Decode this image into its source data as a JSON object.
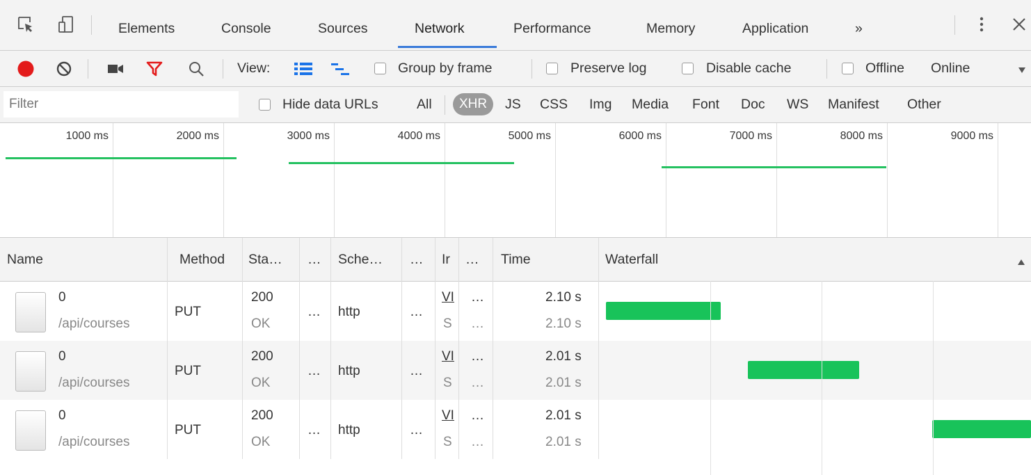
{
  "tabs": {
    "elements": "Elements",
    "console": "Console",
    "sources": "Sources",
    "network": "Network",
    "performance": "Performance",
    "memory": "Memory",
    "application": "Application",
    "more": "»"
  },
  "toolbar": {
    "view_label": "View:",
    "group_by_frame": "Group by frame",
    "preserve_log": "Preserve log",
    "disable_cache": "Disable cache",
    "offline": "Offline",
    "throttle": "Online"
  },
  "filter": {
    "placeholder": "Filter",
    "hide_data_urls": "Hide data URLs",
    "types": [
      "All",
      "XHR",
      "JS",
      "CSS",
      "Img",
      "Media",
      "Font",
      "Doc",
      "WS",
      "Manifest",
      "Other"
    ],
    "active_type": "XHR"
  },
  "overview": {
    "ticks": [
      "1000 ms",
      "2000 ms",
      "3000 ms",
      "4000 ms",
      "5000 ms",
      "6000 ms",
      "7000 ms",
      "8000 ms",
      "9000 ms"
    ]
  },
  "columns": {
    "name": "Name",
    "method": "Method",
    "status": "Sta…",
    "c4": "…",
    "scheme": "Sche…",
    "c6": "…",
    "initiator": "Ir",
    "c8": "…",
    "time": "Time",
    "waterfall": "Waterfall"
  },
  "rows": [
    {
      "name": "0",
      "path": "/api/courses",
      "method": "PUT",
      "status": "200",
      "status_text": "OK",
      "c4": "…",
      "scheme": "http",
      "c6": "…",
      "initiator": "VI",
      "initiator2": "S",
      "c8": "…",
      "c8b": "…",
      "time": "2.10 s",
      "latency": "2.10 s",
      "wf_start": 0.0,
      "wf_end": 2.1
    },
    {
      "name": "0",
      "path": "/api/courses",
      "method": "PUT",
      "status": "200",
      "status_text": "OK",
      "c4": "…",
      "scheme": "http",
      "c6": "…",
      "initiator": "VI",
      "initiator2": "S",
      "c8": "…",
      "c8b": "…",
      "time": "2.01 s",
      "latency": "2.01 s",
      "wf_start": 2.6,
      "wf_end": 4.61
    },
    {
      "name": "0",
      "path": "/api/courses",
      "method": "PUT",
      "status": "200",
      "status_text": "OK",
      "c4": "…",
      "scheme": "http",
      "c6": "…",
      "initiator": "VI",
      "initiator2": "S",
      "c8": "…",
      "c8b": "…",
      "time": "2.01 s",
      "latency": "2.01 s",
      "wf_start": 6.0,
      "wf_end": 8.01
    }
  ],
  "colors": {
    "record": "#e31b1b",
    "filter_active": "#e31b1b",
    "bar": "#18c35a",
    "accent": "#3879d9"
  }
}
